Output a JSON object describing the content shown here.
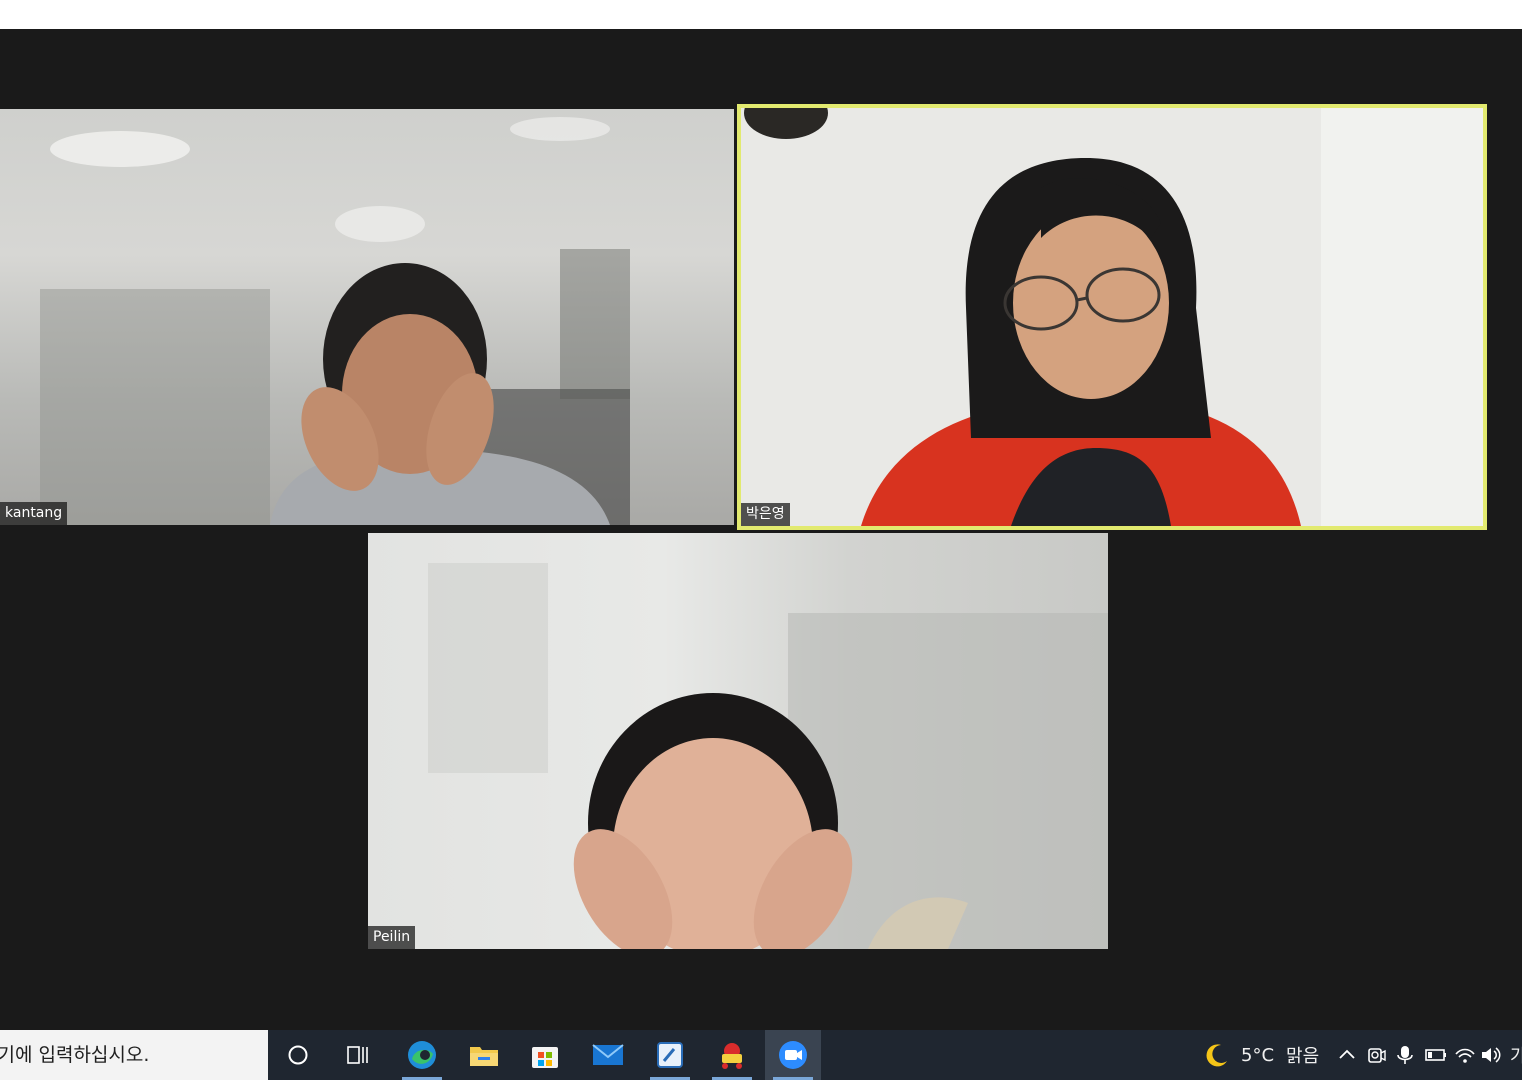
{
  "participants": [
    {
      "name": "kantang"
    },
    {
      "name": "박은영",
      "active_speaker": true
    },
    {
      "name": "Peilin"
    }
  ],
  "taskbar": {
    "search_placeholder": "여기에 입력하십시오.",
    "apps": [
      "cortana-icon",
      "task-view-icon",
      "edge-icon",
      "file-explorer-icon",
      "microsoft-store-icon",
      "mail-icon",
      "notes-app-icon",
      "pdf-app-icon",
      "zoom-icon"
    ],
    "weather_temp": "5°C",
    "weather_desc": "맑음",
    "ime_partial": "가"
  },
  "colors": {
    "active_speaker_border": "#e2ea6f",
    "stage_bg": "#1a1a1a",
    "taskbar_bg": "#1f2630"
  }
}
